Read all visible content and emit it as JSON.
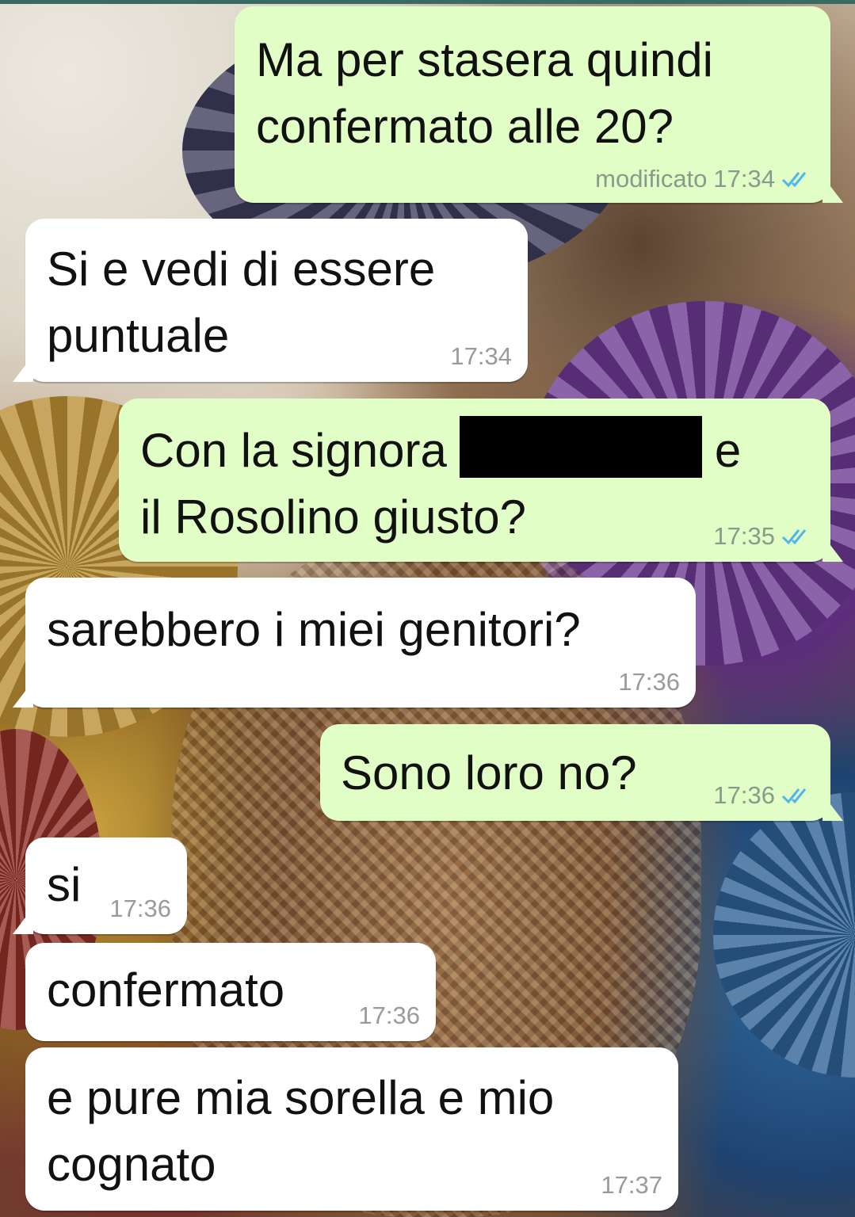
{
  "messages": [
    {
      "dir": "out",
      "text": [
        "Ma per stasera quindi",
        "confermato alle 20?"
      ],
      "edited_label": "modificato",
      "time": "17:34",
      "status_icon": "double-check-icon"
    },
    {
      "dir": "in",
      "text": [
        "Si e vedi di essere",
        "puntuale"
      ],
      "time": "17:34"
    },
    {
      "dir": "out",
      "text_a": "Con la signora",
      "text_b": "e",
      "text_c": "il Rosolino giusto?",
      "time": "17:35",
      "status_icon": "double-check-icon"
    },
    {
      "dir": "in",
      "text": [
        "sarebbero i miei genitori?"
      ],
      "time": "17:36"
    },
    {
      "dir": "out",
      "text": [
        "Sono loro no?"
      ],
      "time": "17:36",
      "status_icon": "double-check-icon"
    },
    {
      "dir": "in",
      "text": [
        "si"
      ],
      "time": "17:36"
    },
    {
      "dir": "in",
      "text": [
        "confermato"
      ],
      "time": "17:36"
    },
    {
      "dir": "in",
      "text": [
        "e pure mia sorella e mio",
        "cognato"
      ],
      "time": "17:37"
    }
  ],
  "colors": {
    "outgoing_bubble": "#e1fec6",
    "incoming_bubble": "#ffffff",
    "tick_read": "#4fb6ec"
  }
}
